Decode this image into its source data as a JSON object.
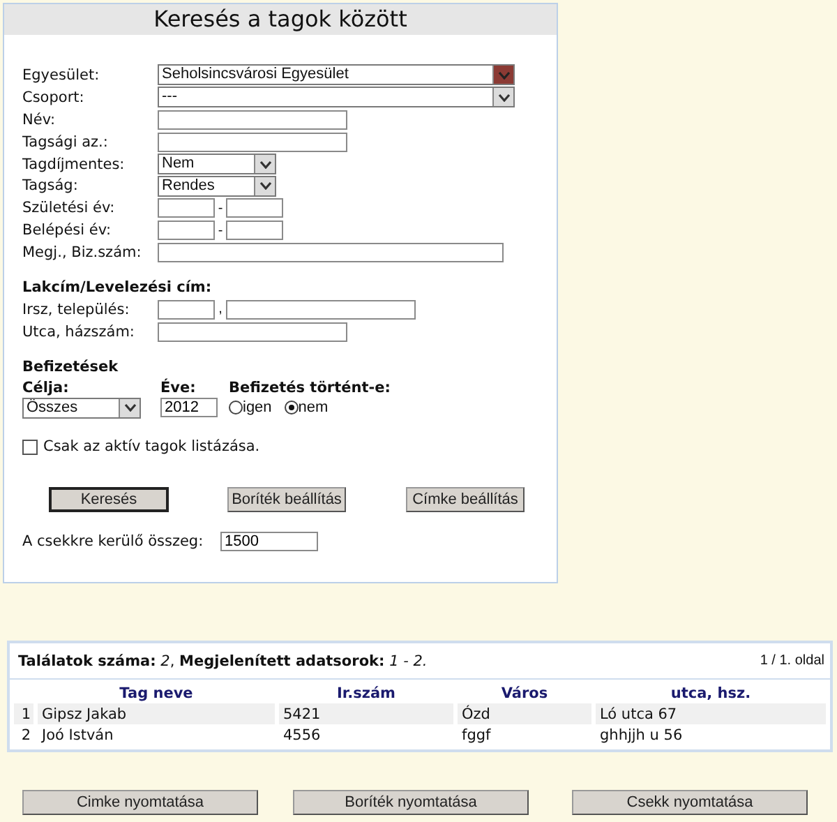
{
  "title": "Keresés a tagok között",
  "fields": [
    {
      "kind": "select",
      "label": "Egyesület:",
      "value": "Seholsincsvárosi Egyesület",
      "highlighted": true
    },
    {
      "kind": "select",
      "label": "Csoport:",
      "value": "---",
      "highlighted": false
    },
    {
      "kind": "text",
      "label": "Név:"
    },
    {
      "kind": "text",
      "label": "Tagsági az.:"
    },
    {
      "kind": "short_select",
      "label": "Tagdíjmentes:",
      "value": "Nem",
      "highlighted": false
    },
    {
      "kind": "short_select",
      "label": "Tagság:",
      "value": "Rendes",
      "highlighted": false
    },
    {
      "kind": "range",
      "label": "Születési év:",
      "separator": "-"
    },
    {
      "kind": "range",
      "label": "Belépési év:",
      "separator": "-"
    },
    {
      "kind": "long_text",
      "label": "Megj., Biz.szám:"
    }
  ],
  "address": {
    "heading": "Lakcím/Levelezési cím:",
    "fields": [
      {
        "kind": "zip_city",
        "label": "Irsz, település:",
        "separator": ","
      },
      {
        "kind": "text",
        "label": "Utca, házszám:"
      }
    ]
  },
  "payments": {
    "heading": "Befizetések",
    "purpose_label": "Célja:",
    "purpose_value": "Összes",
    "year_label": "Éve:",
    "year_value": "2012",
    "paid_label": "Befizetés történt-e:",
    "options": [
      {
        "label": "igen",
        "selected": false
      },
      {
        "label": "nem",
        "selected": true
      }
    ]
  },
  "active_only": {
    "label": "Csak az aktív tagok listázása.",
    "checked": false
  },
  "buttons": [
    {
      "label": "Keresés",
      "default": true
    },
    {
      "label": "Boríték beállítás",
      "default": false
    },
    {
      "label": "Címke beállítás",
      "default": false
    }
  ],
  "amount": {
    "label": "A csekkre kerülő összeg:",
    "value": "1500"
  },
  "results": {
    "summary": "**Találatok száma:** *2*, **Megjelenített adatsorok:** *1 - 2.*",
    "pager": "1 / 1. oldal",
    "columns": [
      "Tag neve",
      "Ir.szám",
      "Város",
      "utca, hsz."
    ],
    "rows": [
      {
        "index": "1",
        "cells": [
          "Gipsz Jakab",
          "5421",
          "Ózd",
          "Ló utca 67"
        ]
      },
      {
        "index": "2",
        "cells": [
          "Joó István",
          "4556",
          "fggf",
          "ghhjjh u 56"
        ]
      }
    ]
  },
  "print_buttons": [
    "Cimke nyomtatása",
    "Boríték nyomtatása",
    "Csekk nyomtatása"
  ]
}
